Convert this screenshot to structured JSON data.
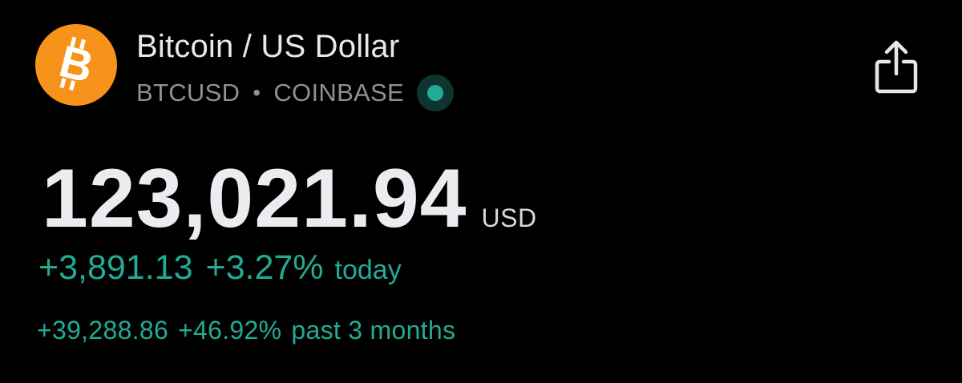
{
  "header": {
    "title": "Bitcoin / US Dollar",
    "symbol": "BTCUSD",
    "separator": "•",
    "exchange": "COINBASE",
    "logo_icon": "bitcoin-icon",
    "status_icon": "market-open-icon",
    "share_icon": "share-icon"
  },
  "quote": {
    "price": "123,021.94",
    "currency": "USD"
  },
  "change_today": {
    "value": "+3,891.13",
    "percent": "+3.27%",
    "label": "today"
  },
  "change_period": {
    "value": "+39,288.86",
    "percent": "+46.92%",
    "label": "past 3 months"
  },
  "colors": {
    "background": "#000000",
    "bitcoin_orange": "#f7931a",
    "positive_green": "#22ab94",
    "primary_text": "#ececf0",
    "secondary_text": "#8f8f98"
  }
}
